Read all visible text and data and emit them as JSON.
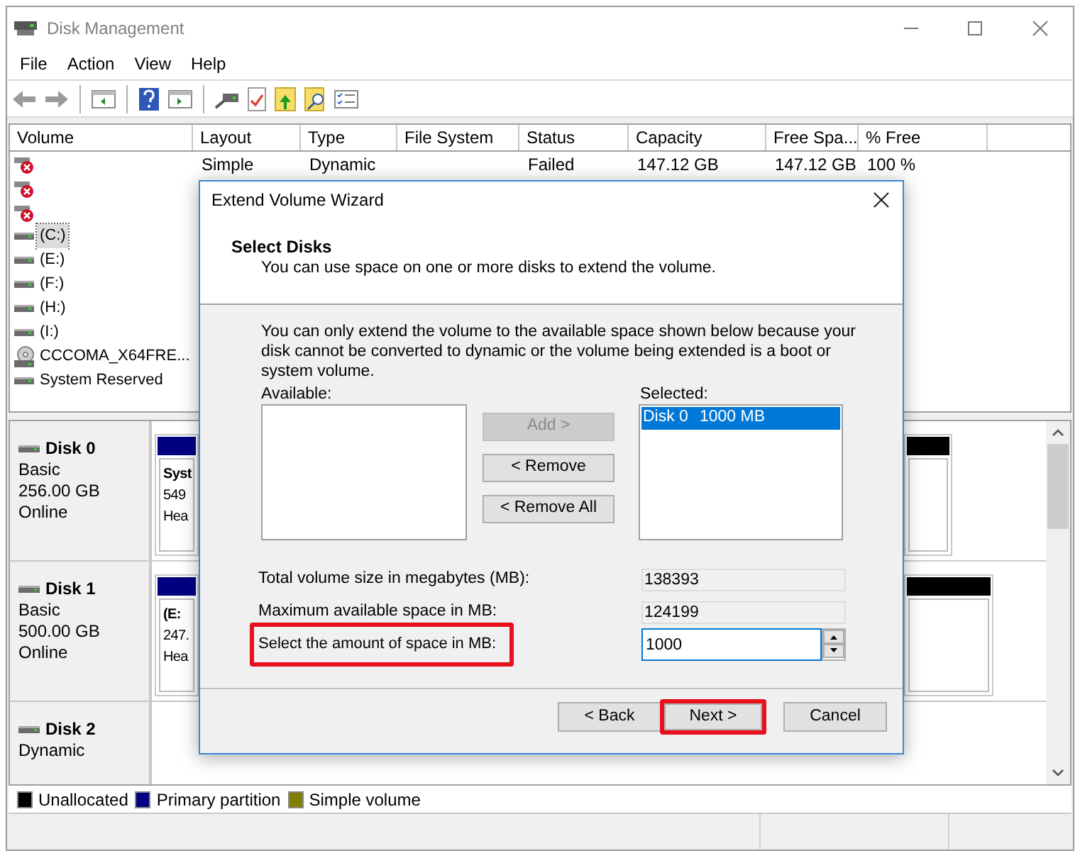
{
  "window": {
    "title": "Disk Management"
  },
  "menu": [
    {
      "label": "File"
    },
    {
      "label": "Action"
    },
    {
      "label": "View"
    },
    {
      "label": "Help"
    }
  ],
  "volume_table": {
    "columns": [
      "Volume",
      "Layout",
      "Type",
      "File System",
      "Status",
      "Capacity",
      "Free Spa...",
      "% Free"
    ],
    "rows": [
      {
        "kind": "error",
        "selected": false,
        "layout": "Simple",
        "type": "Dynamic",
        "status": "Failed",
        "capacity": "147.12 GB",
        "free_space": "147.12 GB",
        "percent_free": "100 %"
      },
      {
        "kind": "error",
        "selected": false
      },
      {
        "kind": "error",
        "selected": false
      },
      {
        "kind": "drive",
        "volume": "(C:)",
        "selected": true
      },
      {
        "kind": "drive",
        "volume": "(E:)",
        "selected": false
      },
      {
        "kind": "drive",
        "volume": "(F:)",
        "selected": false
      },
      {
        "kind": "drive",
        "volume": "(H:)",
        "selected": false
      },
      {
        "kind": "drive",
        "volume": "(I:)",
        "selected": false
      },
      {
        "kind": "cdrom",
        "volume": "CCCOMA_X64FRE...",
        "selected": false
      },
      {
        "kind": "drive",
        "volume": "System Reserved",
        "selected": false
      }
    ]
  },
  "disks": [
    {
      "name": "Disk 0",
      "lines": [
        "Basic",
        "256.00 GB",
        "Online"
      ],
      "partitions": [
        {
          "kind": "primary",
          "lines": [
            "Syst",
            "549",
            "Hea"
          ]
        },
        {
          "kind": "unallocated"
        }
      ]
    },
    {
      "name": "Disk 1",
      "lines": [
        "Basic",
        "500.00 GB",
        "Online"
      ],
      "partitions": [
        {
          "kind": "primary",
          "lines": [
            "(E:",
            "247.",
            "Hea"
          ]
        },
        {
          "kind": "unallocated"
        }
      ]
    },
    {
      "name": "Disk 2",
      "lines": [
        "Dynamic"
      ]
    }
  ],
  "legend": [
    {
      "label": "Unallocated",
      "color": "#000000"
    },
    {
      "label": "Primary partition",
      "color": "#000080"
    },
    {
      "label": "Simple volume",
      "color": "#808000"
    }
  ],
  "dialog": {
    "title": "Extend Volume Wizard",
    "heading": "Select Disks",
    "subheading": "You can use space on one or more disks to extend the volume.",
    "note": "You can only extend the volume to the available space shown below because your disk cannot be converted to dynamic or the volume being extended is a boot or system volume.",
    "available_label": "Available:",
    "move_buttons": [
      {
        "label": "Add >",
        "disabled": true
      },
      {
        "label": "< Remove",
        "disabled": false
      },
      {
        "label": "< Remove All",
        "disabled": false
      }
    ],
    "selected_label": "Selected:",
    "selected_items": [
      {
        "disk": "Disk 0",
        "size": "1000 MB",
        "selected": true
      }
    ],
    "fields": [
      {
        "kind": "readonly",
        "label": "Total volume size in megabytes (MB):",
        "value": "138393",
        "highlighted": false
      },
      {
        "kind": "readonly",
        "label": "Maximum available space in MB:",
        "value": "124199",
        "highlighted": false
      },
      {
        "kind": "spin",
        "label": "Select the amount of space in MB:",
        "value": "1000",
        "highlighted": true
      }
    ],
    "footer_buttons": [
      {
        "label": "< Back",
        "highlighted": false
      },
      {
        "label": "Next >",
        "highlighted": true
      },
      {
        "label": "Cancel",
        "highlighted": false
      }
    ]
  }
}
